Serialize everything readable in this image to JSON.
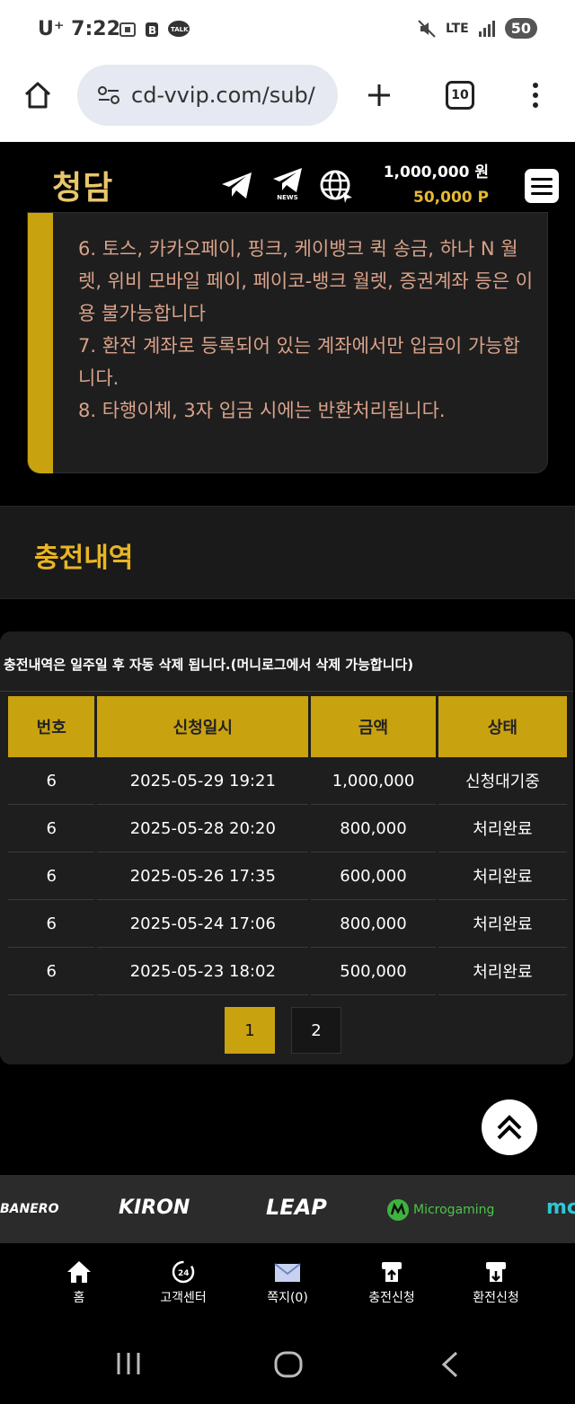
{
  "status_bar": {
    "carrier": "U⁺",
    "time": "7:22",
    "network": "LTE",
    "battery": "50",
    "colors": {
      "background": "#ffffff",
      "text": "#333333"
    }
  },
  "browser": {
    "url": "cd-vvip.com/sub/",
    "tab_count": "10"
  },
  "header": {
    "logo_text": "청담",
    "news_label": "NEWS",
    "cash_balance": "1,000,000 원",
    "points_balance": "50,000 P",
    "colors": {
      "logo": "#e8c66a",
      "points": "#e5b932"
    }
  },
  "notice": {
    "lines": [
      "6. 토스, 카카오페이, 핑크, 케이뱅크 퀵 송금, 하나 N 월렛, 위비 모바일 페이, 페이코-뱅크 월렛, 증권계좌 등은 이용 불가능합니다",
      "7. 환전 계좌로 등록되어 있는 계좌에서만 입금이 가능합니다.",
      "8. 타행이체, 3자 입금 시에는 반환처리됩니다."
    ],
    "colors": {
      "text": "#d9a28a",
      "accent_bar": "#c9a20f"
    }
  },
  "section": {
    "title": "충전내역"
  },
  "history": {
    "note": "충전내역은 일주일 후 자동 삭제 됩니다.(머니로그에서 삭제 가능합니다)",
    "columns": [
      "번호",
      "신청일시",
      "금액",
      "상태"
    ],
    "rows": [
      [
        "6",
        "2025-05-29 19:21",
        "1,000,000",
        "신청대기중"
      ],
      [
        "6",
        "2025-05-28 20:20",
        "800,000",
        "처리완료"
      ],
      [
        "6",
        "2025-05-26 17:35",
        "600,000",
        "처리완료"
      ],
      [
        "6",
        "2025-05-24 17:06",
        "800,000",
        "처리완료"
      ],
      [
        "6",
        "2025-05-23 18:02",
        "500,000",
        "처리완료"
      ]
    ],
    "pages": [
      "1",
      "2"
    ],
    "current_page": "1",
    "colors": {
      "header_bg": "#c9a20f",
      "row_divider": "#3a3a3a"
    }
  },
  "providers": [
    "BANERO",
    "KIRON",
    "LEAP",
    "Microgaming",
    "mc"
  ],
  "bottom_nav": [
    {
      "label": "홈",
      "icon": "home-icon"
    },
    {
      "label": "고객센터",
      "icon": "support-24-icon"
    },
    {
      "label": "쪽지(0)",
      "icon": "mail-icon"
    },
    {
      "label": "충전신청",
      "icon": "deposit-icon"
    },
    {
      "label": "환전신청",
      "icon": "withdraw-icon"
    }
  ]
}
